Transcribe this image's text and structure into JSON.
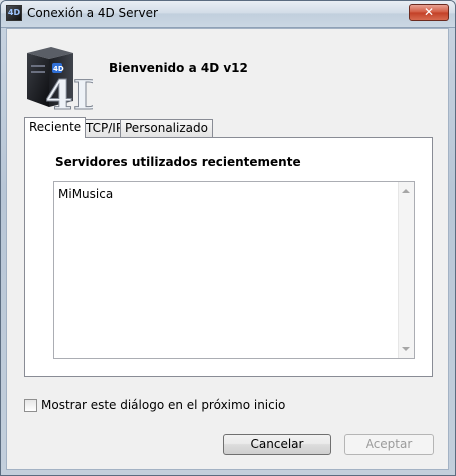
{
  "window": {
    "title": "Conexión a 4D Server",
    "close_label": "✕",
    "app_icon_label": "4D"
  },
  "header": {
    "welcome": "Bienvenido a 4D v12",
    "logo_text": "4D"
  },
  "tabs": [
    {
      "label": "Reciente",
      "active": true
    },
    {
      "label": "TCP/IP",
      "active": false
    },
    {
      "label": "Personalizado",
      "active": false
    }
  ],
  "recent": {
    "heading": "Servidores utilizados recientemente",
    "servers": [
      "MiMusica"
    ]
  },
  "options": {
    "show_dialog_label": "Mostrar este diálogo en el próximo inicio",
    "show_dialog_checked": false
  },
  "buttons": {
    "cancel": "Cancelar",
    "accept": "Aceptar"
  }
}
